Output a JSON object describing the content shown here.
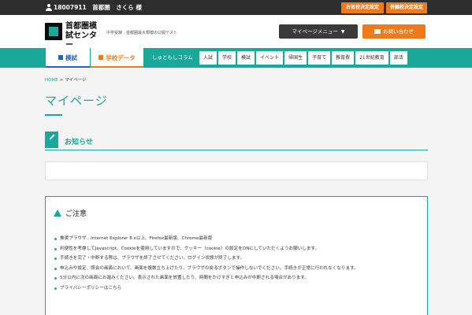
{
  "topbar": {
    "user_text": "18007911　首都圏　さくら 様",
    "btn_favorite_settings": "お気校決定設定",
    "btn_exam_settings": "併願校決定設定"
  },
  "header": {
    "logo_text": "首都圏模試センター",
    "tagline": "中学受験　首都圏最大規模の公開テスト",
    "mypage_menu_label": "マイページメニュー",
    "contact_label": "お問い合わせ"
  },
  "nav": {
    "tab_exam": "模試",
    "tab_school_data": "学校データ",
    "column_label": "しゅともしコラム",
    "items": [
      "入試",
      "学校",
      "模試",
      "イベント",
      "帰国生",
      "子育て",
      "教育費",
      "21世紀教育",
      "部活"
    ]
  },
  "breadcrumb": {
    "home": "HOME",
    "separator": ">",
    "current": "マイページ"
  },
  "page_title": "マイページ",
  "notice_section": {
    "title": "お知らせ"
  },
  "caution": {
    "title": "ご注意",
    "items": [
      "推奨ブラウザ…Internet Explorer 8.x以上、Firefox最新版、Chrome最新版",
      "利便性を考慮してJavascript、Cookieを使用していますので、クッキー（cookie）の設定をONにしていただくようお願いします。",
      "手続きを完了・中断する際は、ブラウザを終了させてください。ログイン状態が終了します。",
      "申込みや設定、照会の画面において、画面を複数立ち上げたり、ブラウザの戻るボタンで操作しないでください。手続きが正常に行われなくなります。",
      "5分以内に次の画面にお進みください。表示された画面を放置したり、時間をかけすぎと申込みが中断される場合があります。",
      "プライバシーポリシーはこちら"
    ]
  },
  "colors": {
    "accent": "#19a89a",
    "orange": "#f07a1a",
    "dark": "#2d2d2d",
    "blue": "#2762c7"
  }
}
